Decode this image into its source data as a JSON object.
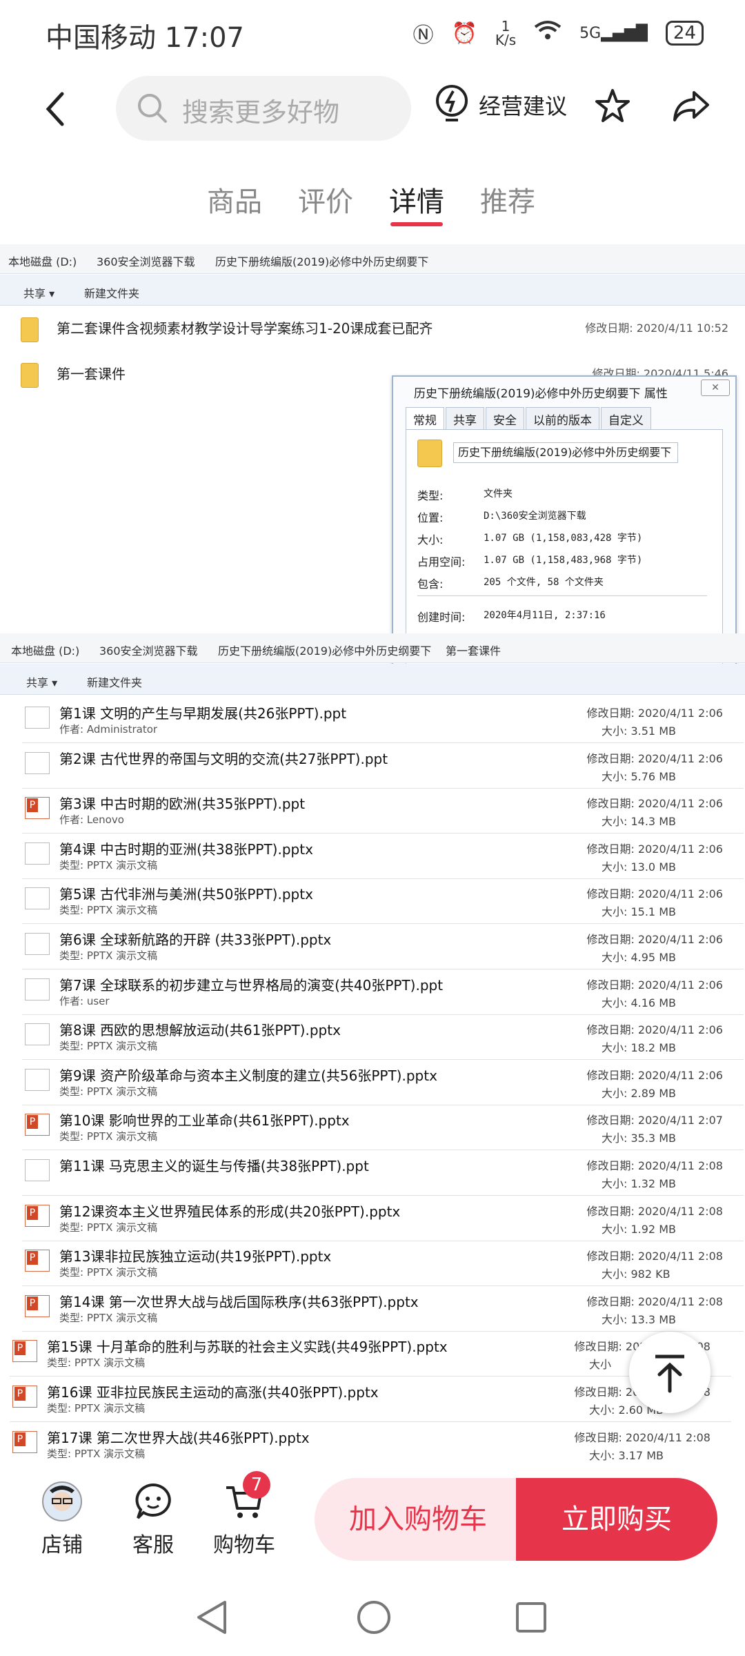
{
  "status_bar": {
    "carrier_time": "中国移动 17:07",
    "speed_top": "1",
    "speed_unit": "K/s",
    "network": "5G",
    "battery": "24"
  },
  "header": {
    "search_placeholder": "搜索更多好物",
    "advice_label": "经营建议"
  },
  "tabs": [
    "商品",
    "评价",
    "详情",
    "推荐"
  ],
  "explorer1": {
    "breadcrumb": [
      "本地磁盘 (D:)",
      "360安全浏览器下载",
      "历史下册统编版(2019)必修中外历史纲要下"
    ],
    "tool_share": "共享 ▾",
    "tool_newfolder": "新建文件夹",
    "folders": [
      {
        "name": "第二套课件含视频素材教学设计导学案练习1-20课成套已配齐",
        "date": "修改日期: 2020/4/11 10:52"
      },
      {
        "name": "第一套课件",
        "date": "修改日期: 2020/4/11 5:46"
      }
    ]
  },
  "dialog": {
    "title": "历史下册统编版(2019)必修中外历史纲要下 属性",
    "tabs": [
      "常规",
      "共享",
      "安全",
      "以前的版本",
      "自定义"
    ],
    "name_value": "历史下册统编版(2019)必修中外历史纲要下",
    "rows": [
      {
        "k": "类型:",
        "v": "文件夹"
      },
      {
        "k": "位置:",
        "v": "D:\\360安全浏览器下载"
      },
      {
        "k": "大小:",
        "v": "1.07 GB (1,158,083,428 字节)"
      },
      {
        "k": "占用空间:",
        "v": "1.07 GB (1,158,483,968 字节)"
      },
      {
        "k": "包含:",
        "v": "205 个文件, 58 个文件夹"
      },
      {
        "k": "创建时间:",
        "v": "2020年4月11日, 2:37:16"
      }
    ]
  },
  "explorer2": {
    "breadcrumb": [
      "本地磁盘 (D:)",
      "360安全浏览器下载",
      "历史下册统编版(2019)必修中外历史纲要下",
      "第一套课件"
    ],
    "tool_share": "共享 ▾",
    "tool_newfolder": "新建文件夹",
    "files": [
      {
        "name": "第1课 文明的产生与早期发展(共26张PPT).ppt",
        "sub": "作者: Administrator",
        "date": "修改日期: 2020/4/11 2:06",
        "size": "大小: 3.51 MB",
        "icon": "thumb"
      },
      {
        "name": "第2课 古代世界的帝国与文明的交流(共27张PPT).ppt",
        "sub": "",
        "date": "修改日期: 2020/4/11 2:06",
        "size": "大小: 5.76 MB",
        "icon": "thumb"
      },
      {
        "name": "第3课 中古时期的欧洲(共35张PPT).ppt",
        "sub": "作者: Lenovo",
        "date": "修改日期: 2020/4/11 2:06",
        "size": "大小: 14.3 MB",
        "icon": "ppt"
      },
      {
        "name": "第4课 中古时期的亚洲(共38张PPT).pptx",
        "sub": "类型: PPTX 演示文稿",
        "date": "修改日期: 2020/4/11 2:06",
        "size": "大小: 13.0 MB",
        "icon": "thumb"
      },
      {
        "name": "第5课 古代非洲与美洲(共50张PPT).pptx",
        "sub": "类型: PPTX 演示文稿",
        "date": "修改日期: 2020/4/11 2:06",
        "size": "大小: 15.1 MB",
        "icon": "thumb"
      },
      {
        "name": "第6课 全球新航路的开辟 (共33张PPT).pptx",
        "sub": "类型: PPTX 演示文稿",
        "date": "修改日期: 2020/4/11 2:06",
        "size": "大小: 4.95 MB",
        "icon": "thumb"
      },
      {
        "name": "第7课 全球联系的初步建立与世界格局的演变(共40张PPT).ppt",
        "sub": "作者: user",
        "date": "修改日期: 2020/4/11 2:06",
        "size": "大小: 4.16 MB",
        "icon": "thumb"
      },
      {
        "name": "第8课 西欧的思想解放运动(共61张PPT).pptx",
        "sub": "类型: PPTX 演示文稿",
        "date": "修改日期: 2020/4/11 2:06",
        "size": "大小: 18.2 MB",
        "icon": "thumb"
      },
      {
        "name": "第9课 资产阶级革命与资本主义制度的建立(共56张PPT).pptx",
        "sub": "类型: PPTX 演示文稿",
        "date": "修改日期: 2020/4/11 2:06",
        "size": "大小: 2.89 MB",
        "icon": "thumb"
      },
      {
        "name": "第10课 影响世界的工业革命(共61张PPT).pptx",
        "sub": "类型: PPTX 演示文稿",
        "date": "修改日期: 2020/4/11 2:07",
        "size": "大小: 35.3 MB",
        "icon": "ppt"
      },
      {
        "name": "第11课 马克思主义的诞生与传播(共38张PPT).ppt",
        "sub": "",
        "date": "修改日期: 2020/4/11 2:08",
        "size": "大小: 1.32 MB",
        "icon": "thumb"
      },
      {
        "name": "第12课资本主义世界殖民体系的形成(共20张PPT).pptx",
        "sub": "类型: PPTX 演示文稿",
        "date": "修改日期: 2020/4/11 2:08",
        "size": "大小: 1.92 MB",
        "icon": "ppt"
      },
      {
        "name": "第13课非拉民族独立运动(共19张PPT).pptx",
        "sub": "类型: PPTX 演示文稿",
        "date": "修改日期: 2020/4/11 2:08",
        "size": "大小: 982 KB",
        "icon": "ppt"
      },
      {
        "name": "第14课 第一次世界大战与战后国际秩序(共63张PPT).pptx",
        "sub": "类型: PPTX 演示文稿",
        "date": "修改日期: 2020/4/11 2:08",
        "size": "大小: 13.3 MB",
        "icon": "ppt"
      },
      {
        "name": "第15课 十月革命的胜利与苏联的社会主义实践(共49张PPT).pptx",
        "sub": "类型: PPTX 演示文稿",
        "date": "修改日期: 2020/4/11 2:08",
        "size": "大小",
        "icon": "ppt"
      },
      {
        "name": "第16课 亚非拉民族民主运动的高涨(共40张PPT).pptx",
        "sub": "类型: PPTX 演示文稿",
        "date": "修改日期: 2020/4/11 2:08",
        "size": "大小: 2.60 MB",
        "icon": "ppt"
      },
      {
        "name": "第17课 第二次世界大战(共46张PPT).pptx",
        "sub": "类型: PPTX 演示文稿",
        "date": "修改日期: 2020/4/11 2:08",
        "size": "大小: 3.17 MB",
        "icon": "ppt"
      }
    ]
  },
  "action_bar": {
    "shop": "店铺",
    "service": "客服",
    "cart": "购物车",
    "cart_count": "7",
    "add_to_cart": "加入购物车",
    "buy_now": "立即购买"
  },
  "colors": {
    "accent": "#e6344a",
    "accent_light": "#fde7ea"
  }
}
